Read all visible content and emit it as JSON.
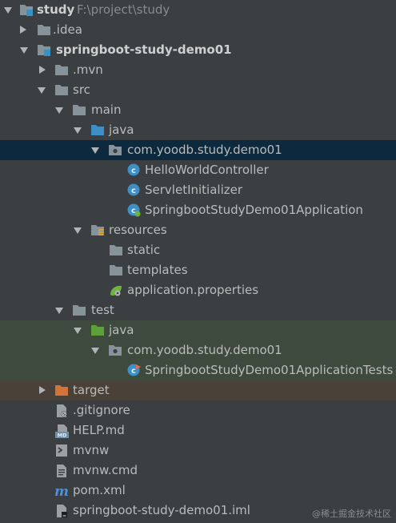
{
  "project_tree": {
    "root": {
      "name": "study",
      "path": "F:\\project\\study"
    },
    "idea": "idea",
    "module": "springboot-study-demo01",
    "mvn": ".mvn",
    "src": "src",
    "main": "main",
    "main_java": "java",
    "main_package": "com.yoodb.study.demo01",
    "class_hello": "HelloWorldController",
    "class_servlet": "ServletInitializer",
    "class_app": "SpringbootStudyDemo01Application",
    "resources": "resources",
    "static": "static",
    "templates": "templates",
    "app_props": "application.properties",
    "test": "test",
    "test_java": "java",
    "test_package": "com.yoodb.study.demo01",
    "class_tests": "SpringbootStudyDemo01ApplicationTests",
    "target": "target",
    "gitignore": ".gitignore",
    "help": "HELP.md",
    "mvnw": "mvnw",
    "mvnw_cmd": "mvnw.cmd",
    "pom": "pom.xml",
    "iml": "springboot-study-demo01.iml"
  },
  "watermark": "@稀土掘金技术社区"
}
